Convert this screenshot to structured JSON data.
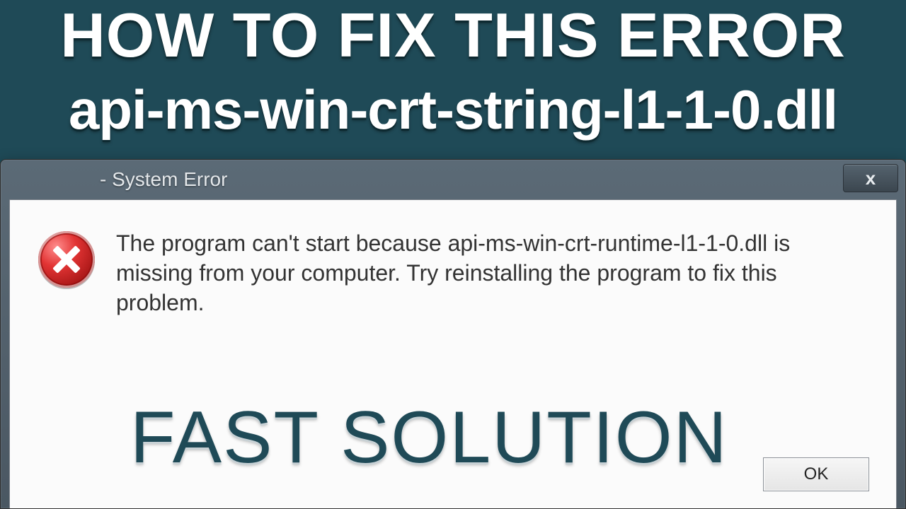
{
  "headline": "HOW TO FIX THIS ERROR",
  "subhead": "api-ms-win-crt-string-l1-1-0.dll",
  "dialog": {
    "title": "- System Error",
    "close_glyph": "x",
    "message": "The program can't start because api-ms-win-crt-runtime-l1-1-0.dll is missing from your computer. Try reinstalling the program to fix this problem.",
    "ok_label": "OK"
  },
  "footer_tag": "FAST SOLUTION"
}
